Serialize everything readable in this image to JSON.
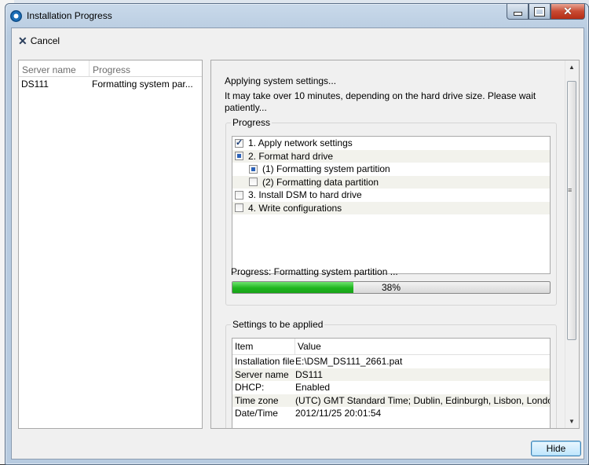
{
  "window": {
    "title": "Installation Progress"
  },
  "toolbar": {
    "cancel_label": "Cancel"
  },
  "server_list": {
    "headers": [
      "Server name",
      "Progress"
    ],
    "rows": [
      {
        "name": "DS111",
        "progress": "Formatting system par..."
      }
    ]
  },
  "status": {
    "heading": "Applying system settings...",
    "note": "It may take over 10 minutes, depending on the hard drive size. Please wait patiently..."
  },
  "progress_group": {
    "label": "Progress",
    "steps": [
      {
        "label": "1. Apply network settings",
        "state": "checked"
      },
      {
        "label": "2. Format hard drive",
        "state": "partial"
      },
      {
        "label": "(1) Formatting system partition",
        "state": "partial"
      },
      {
        "label": "(2) Formatting data partition",
        "state": "unchecked"
      },
      {
        "label": "3. Install DSM to hard drive",
        "state": "unchecked"
      },
      {
        "label": "4. Write configurations",
        "state": "unchecked"
      }
    ],
    "current": "Progress: Formatting system partition ...",
    "percent_label": "38%",
    "percent": 38,
    "bar_color": "#1fb51f"
  },
  "settings_group": {
    "label": "Settings to be applied",
    "headers": [
      "Item",
      "Value"
    ],
    "rows": [
      {
        "item": "Installation file",
        "value": "E:\\DSM_DS111_2661.pat"
      },
      {
        "item": "Server name",
        "value": "DS111"
      },
      {
        "item": "DHCP:",
        "value": "Enabled"
      },
      {
        "item": "Time zone",
        "value": "(UTC) GMT Standard Time; Dublin, Edinburgh, Lisbon, London"
      },
      {
        "item": "Date/Time",
        "value": "2012/11/25 20:01:54"
      }
    ]
  },
  "footer": {
    "hide_label": "Hide"
  }
}
